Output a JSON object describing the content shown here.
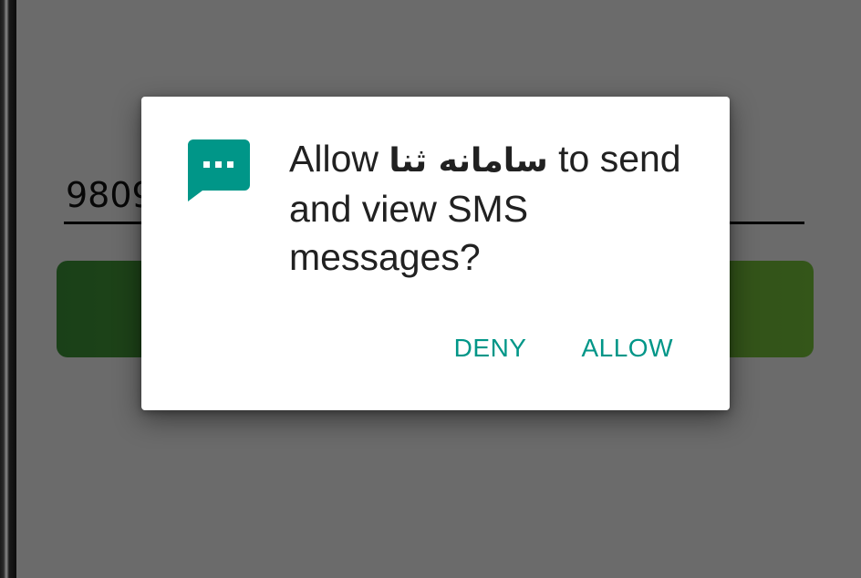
{
  "background_app": {
    "phone_input_value": "9809",
    "submit_button_color": "#5dab3a"
  },
  "dialog": {
    "icon": "sms-message-icon",
    "message_prefix": "Allow ",
    "app_name": "سامانه ثنا",
    "message_suffix": " to send and view SMS messages?",
    "deny_label": "DENY",
    "allow_label": "ALLOW",
    "accent_color": "#009688"
  }
}
